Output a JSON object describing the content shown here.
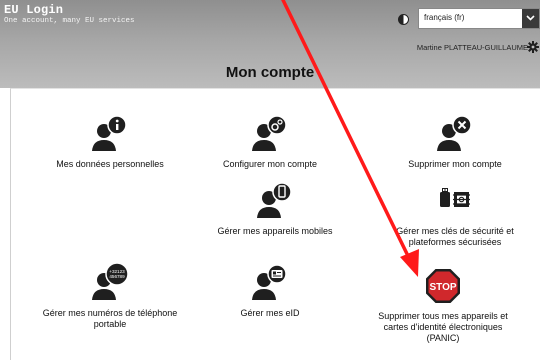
{
  "app": {
    "title": "EU Login",
    "tagline": "One account, many EU services"
  },
  "header": {
    "language": "français (fr)",
    "user": "Martine PLATTEAU-GUILLAUME",
    "page_title": "Mon compte"
  },
  "tiles": {
    "personal_data": "Mes données personnelles",
    "configure": "Configurer mon compte",
    "delete": "Supprimer mon compte",
    "mobile_devices": "Gérer mes appareils mobiles",
    "security_keys": "Gérer mes clés de sécurité et plateformes sécurisées",
    "phone_numbers": "Gérer mes numéros de téléphone portable",
    "eid": "Gérer mes eID",
    "panic": "Supprimer tous mes appareils et cartes d'identité électroniques (PANIC)",
    "phone_icon_text": "+32123 456789",
    "stop_text": "STOP"
  },
  "colors": {
    "annotation_arrow": "#ff1a1a",
    "stop_sign": "#d0282c",
    "icon_dark": "#1f1f1f"
  }
}
